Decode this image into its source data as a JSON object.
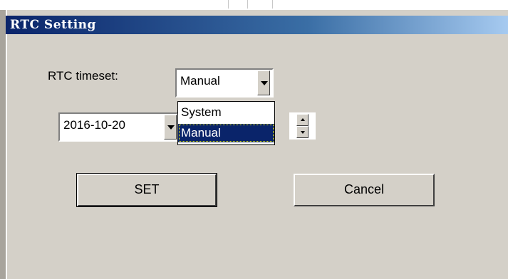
{
  "window": {
    "title": "RTC Setting"
  },
  "form": {
    "timeset_label": "RTC timeset:",
    "timeset_value": "Manual",
    "timeset_options": [
      "System",
      "Manual"
    ],
    "date_value": "2016-10-20"
  },
  "buttons": {
    "set_label": "SET",
    "cancel_label": "Cancel"
  },
  "colors": {
    "title_start": "#0a246a",
    "title_end": "#a6caf0",
    "selection": "#0a246a",
    "face": "#d4d0c8"
  }
}
